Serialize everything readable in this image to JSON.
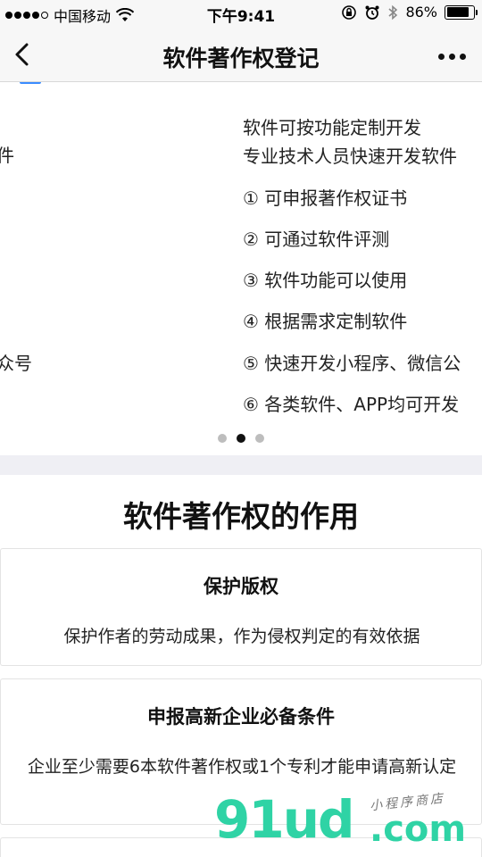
{
  "status_bar": {
    "carrier": "中国移动",
    "time": "下午9:41",
    "battery": "86%",
    "battery_level": 0.86
  },
  "nav": {
    "title": "软件著作权登记"
  },
  "carousel": {
    "prev_fragments": [
      "件",
      "众号"
    ],
    "current_lines": [
      "软件可按功能定制开发",
      "专业技术人员快速开发软件",
      "① 可申报著作权证书",
      "② 可通过软件评测",
      "③ 软件功能可以使用",
      "④ 根据需求定制软件",
      "⑤ 快速开发小程序、微信公",
      "⑥ 各类软件、APP均可开发"
    ],
    "slide_count": 3,
    "active_index": 1
  },
  "section": {
    "title": "软件著作权的作用",
    "cards": [
      {
        "title": "保护版权",
        "desc": "保护作者的劳动成果，作为侵权判定的有效依据"
      },
      {
        "title": "申报高新企业必备条件",
        "desc": "企业至少需要6本软件著作权或1个专利才能申请高新认定"
      }
    ]
  },
  "watermark": {
    "logo": "91ud",
    "suffix": ".com",
    "tagline": "小程序商店"
  }
}
